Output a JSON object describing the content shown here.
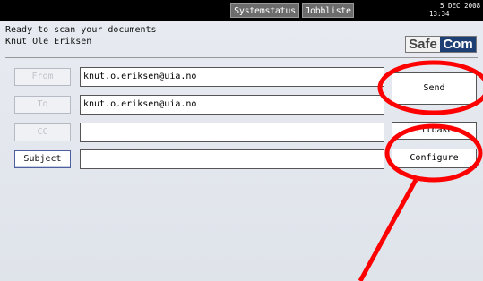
{
  "topbar": {
    "system_status": "Systemstatus",
    "job_list": "Jobbliste",
    "date": "5 DEC  2008",
    "time": "13:34"
  },
  "status": {
    "message": "Ready to scan your documents",
    "user": "Knut Ole Eriksen"
  },
  "logo": {
    "part1": "Safe",
    "part2": "Com"
  },
  "form": {
    "from_label": "From",
    "from_value": "knut.o.eriksen@uia.no",
    "to_label": "To",
    "to_value": "knut.o.eriksen@uia.no",
    "cc_label": "CC",
    "cc_value": "",
    "subject_label": "Subject",
    "subject_value": ""
  },
  "buttons": {
    "send": "Send",
    "back": "Tilbake",
    "configure": "Configure"
  },
  "colors": {
    "annotation": "#ff0000",
    "topbar": "#000000",
    "logo_dark": "#1e3f73"
  }
}
